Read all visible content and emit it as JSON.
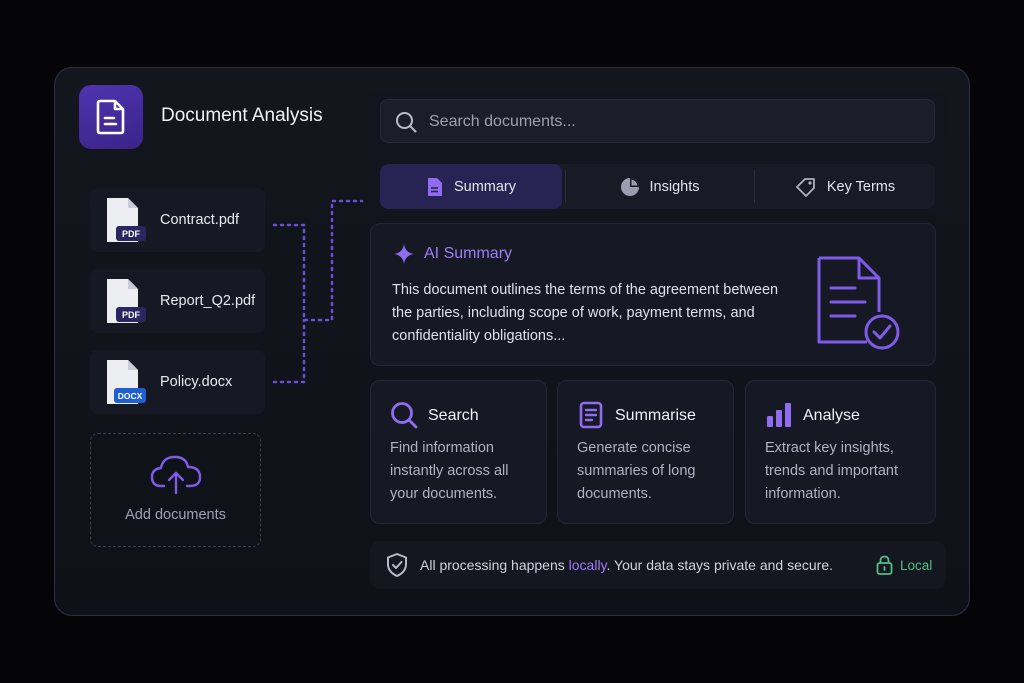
{
  "app": {
    "title": "Document Analysis",
    "logo_icon": "document-icon"
  },
  "files": [
    {
      "name": "Contract.pdf",
      "badge": "PDF",
      "badge_color": "#2b2560"
    },
    {
      "name": "Report_Q2.pdf",
      "badge": "PDF",
      "badge_color": "#2b2560"
    },
    {
      "name": "Policy.docx",
      "badge": "DOCX",
      "badge_color": "#1f5fd1"
    }
  ],
  "add_documents": {
    "label": "Add documents",
    "icon": "cloud-upload-icon"
  },
  "search": {
    "placeholder": "Search documents..."
  },
  "tabs": [
    {
      "label": "Summary",
      "icon": "document-icon",
      "active": true
    },
    {
      "label": "Insights",
      "icon": "pie-chart-icon",
      "active": false
    },
    {
      "label": "Key Terms",
      "icon": "tag-icon",
      "active": false
    }
  ],
  "summary": {
    "title": "AI Summary",
    "icon": "sparkle-icon",
    "body": "This document outlines the terms of the agreement between the parties, including scope of work, payment terms, and confidentiality obligations..."
  },
  "features": [
    {
      "title": "Search",
      "icon": "search-icon",
      "description": "Find information instantly across all your documents."
    },
    {
      "title": "Summarise",
      "icon": "document-lines-icon",
      "description": "Generate concise summaries of long documents."
    },
    {
      "title": "Analyse",
      "icon": "bar-chart-icon",
      "description": "Extract key insights, trends and important information."
    }
  ],
  "footer": {
    "message_before": "All processing happens ",
    "message_highlight": "locally",
    "message_after": ". Your data stays private and secure.",
    "badge": "Local",
    "badge_icon": "lock-icon"
  },
  "colors": {
    "accent": "#9f7cf6",
    "accent_dark": "#4f33b0",
    "success": "#4fbf84",
    "background": "#050507"
  }
}
